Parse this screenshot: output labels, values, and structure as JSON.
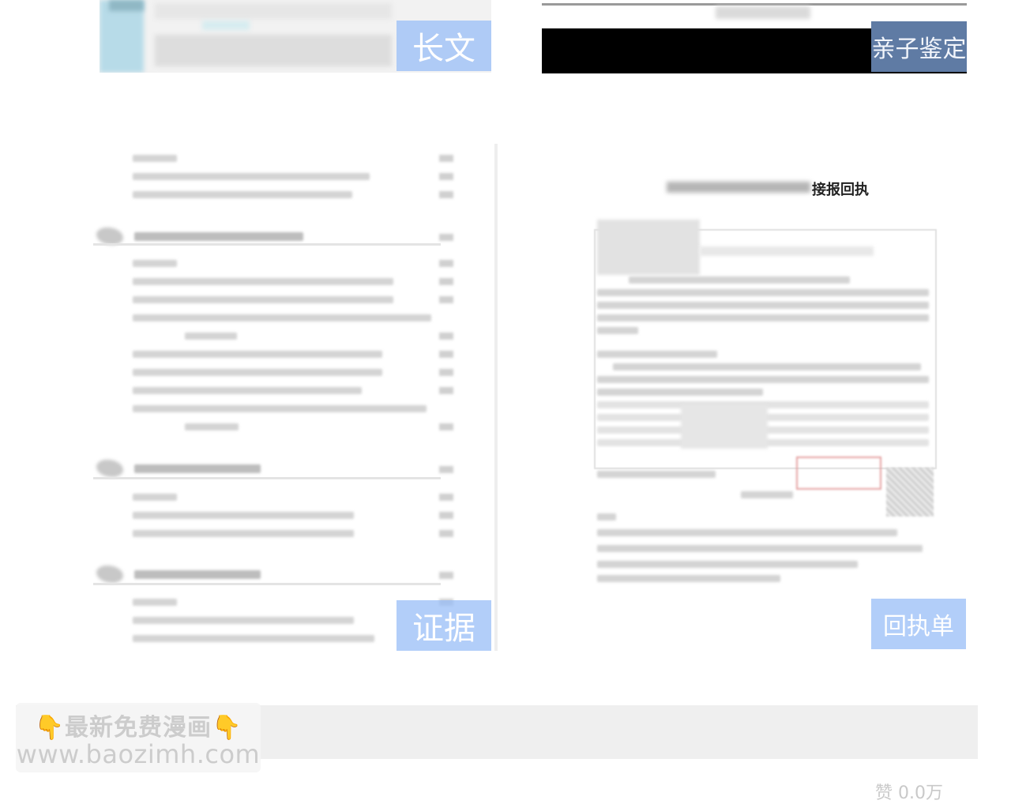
{
  "panels": {
    "long_text": {
      "tag": "长文"
    },
    "paternity": {
      "tag": "亲子鉴定"
    },
    "evidence": {
      "tag": "证据"
    },
    "receipt": {
      "tag": "回执单",
      "title": "接报回执"
    }
  },
  "watermark": {
    "pointer_left": "👇",
    "line1": "最新免费漫画",
    "pointer_right": "👇",
    "line2": "www.baozimh.com"
  },
  "footer": {
    "like_text": "赞 0.0万"
  },
  "colors": {
    "tag_light": "#98bef7",
    "tag_slate": "#5f7ba4",
    "divider_bar": "#efefef"
  }
}
